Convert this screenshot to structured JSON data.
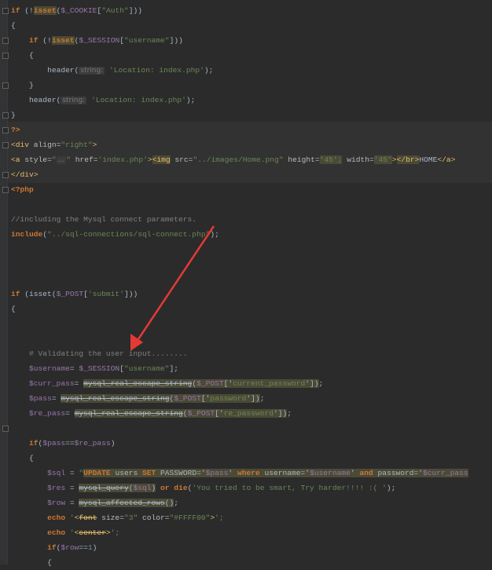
{
  "colors": {
    "background": "#2b2b2b",
    "keyword": "#cc7832",
    "string": "#6a8759",
    "variable": "#9876aa",
    "arrow": "#e53935"
  },
  "annotation": {
    "type": "red-arrow",
    "icon": "arrow-icon"
  },
  "lines": [
    {
      "indent": 0,
      "tokens": [
        {
          "t": "if",
          "c": "kw"
        },
        {
          "t": " (!",
          "c": "fn"
        },
        {
          "t": "isset",
          "c": "kw hl"
        },
        {
          "t": "(",
          "c": "fn"
        },
        {
          "t": "$_COOKIE",
          "c": "var"
        },
        {
          "t": "[",
          "c": "fn"
        },
        {
          "t": "\"Auth\"",
          "c": "str"
        },
        {
          "t": "]))",
          "c": "fn"
        }
      ]
    },
    {
      "indent": 0,
      "tokens": [
        {
          "t": "{",
          "c": "fn"
        }
      ]
    },
    {
      "indent": 1,
      "tokens": [
        {
          "t": "if",
          "c": "kw"
        },
        {
          "t": " (!",
          "c": "fn"
        },
        {
          "t": "isset",
          "c": "kw hl"
        },
        {
          "t": "(",
          "c": "fn"
        },
        {
          "t": "$_SESSION",
          "c": "var"
        },
        {
          "t": "[",
          "c": "fn"
        },
        {
          "t": "\"username\"",
          "c": "str"
        },
        {
          "t": "]))",
          "c": "fn"
        }
      ]
    },
    {
      "indent": 1,
      "tokens": [
        {
          "t": "{",
          "c": "fn"
        }
      ]
    },
    {
      "indent": 2,
      "tokens": [
        {
          "t": "header(",
          "c": "fn"
        },
        {
          "t": "string:",
          "c": "hint"
        },
        {
          "t": " 'Location: index.php'",
          "c": "str"
        },
        {
          "t": ");",
          "c": "fn"
        }
      ]
    },
    {
      "indent": 1,
      "tokens": [
        {
          "t": "}",
          "c": "fn"
        }
      ]
    },
    {
      "indent": 1,
      "tokens": [
        {
          "t": "header(",
          "c": "fn"
        },
        {
          "t": "string:",
          "c": "hint"
        },
        {
          "t": " 'Location: index.php'",
          "c": "str"
        },
        {
          "t": ");",
          "c": "fn"
        }
      ]
    },
    {
      "indent": 0,
      "tokens": [
        {
          "t": "}",
          "c": "fn"
        }
      ]
    },
    {
      "indent": 0,
      "tokens": [
        {
          "t": "?>",
          "c": "kw"
        }
      ]
    },
    {
      "indent": 0,
      "tokens": [
        {
          "t": "<div ",
          "c": "tag"
        },
        {
          "t": "align=",
          "c": "attr"
        },
        {
          "t": "\"right\"",
          "c": "str"
        },
        {
          "t": ">",
          "c": "tag"
        }
      ]
    },
    {
      "indent": 0,
      "tokens": [
        {
          "t": "<a ",
          "c": "tag"
        },
        {
          "t": "style=",
          "c": "attr"
        },
        {
          "t": "\"",
          "c": "str"
        },
        {
          "t": "...",
          "c": "hint"
        },
        {
          "t": "\" ",
          "c": "str"
        },
        {
          "t": "href=",
          "c": "attr"
        },
        {
          "t": "'index.php'",
          "c": "str"
        },
        {
          "t": ">",
          "c": "tag"
        },
        {
          "t": "<img",
          "c": "tag hl"
        },
        {
          "t": " src=",
          "c": "attr"
        },
        {
          "t": "\"../images/Home.png\"",
          "c": "str"
        },
        {
          "t": " height=",
          "c": "attr"
        },
        {
          "t": "'45';",
          "c": "str hl"
        },
        {
          "t": " width=",
          "c": "attr"
        },
        {
          "t": "'45'",
          "c": "str hl"
        },
        {
          "t": ">",
          "c": "tag"
        },
        {
          "t": "</br>",
          "c": "tag hl"
        },
        {
          "t": "HOME",
          "c": "fn"
        },
        {
          "t": "</a>",
          "c": "tag"
        }
      ]
    },
    {
      "indent": 0,
      "tokens": [
        {
          "t": "</div>",
          "c": "tag"
        }
      ]
    },
    {
      "indent": 0,
      "tokens": [
        {
          "t": "<?php",
          "c": "kw"
        }
      ]
    },
    {
      "indent": 0,
      "tokens": []
    },
    {
      "indent": 0,
      "tokens": [
        {
          "t": "//including the Mysql connect parameters.",
          "c": "cm"
        }
      ]
    },
    {
      "indent": 0,
      "tokens": [
        {
          "t": "include",
          "c": "kw"
        },
        {
          "t": "(",
          "c": "fn"
        },
        {
          "t": "\"../sql-connections/sql-connect.php\"",
          "c": "str"
        },
        {
          "t": ");",
          "c": "fn"
        }
      ]
    },
    {
      "indent": 0,
      "tokens": []
    },
    {
      "indent": 0,
      "tokens": []
    },
    {
      "indent": 0,
      "tokens": []
    },
    {
      "indent": 0,
      "tokens": [
        {
          "t": "if",
          "c": "kw"
        },
        {
          "t": " (isset(",
          "c": "fn"
        },
        {
          "t": "$_POST",
          "c": "var"
        },
        {
          "t": "[",
          "c": "fn"
        },
        {
          "t": "'submit'",
          "c": "str"
        },
        {
          "t": "]))",
          "c": "fn"
        }
      ]
    },
    {
      "indent": 0,
      "tokens": [
        {
          "t": "{",
          "c": "fn"
        }
      ]
    },
    {
      "indent": 0,
      "tokens": []
    },
    {
      "indent": 0,
      "tokens": []
    },
    {
      "indent": 1,
      "tokens": [
        {
          "t": "# Validating the user input........",
          "c": "cm"
        }
      ]
    },
    {
      "indent": 1,
      "tokens": [
        {
          "t": "$username",
          "c": "var"
        },
        {
          "t": "= ",
          "c": "fn"
        },
        {
          "t": "$_SESSION",
          "c": "var"
        },
        {
          "t": "[",
          "c": "fn"
        },
        {
          "t": "\"username\"",
          "c": "str"
        },
        {
          "t": "];",
          "c": "fn"
        }
      ]
    },
    {
      "indent": 1,
      "tokens": [
        {
          "t": "$curr_pass",
          "c": "var"
        },
        {
          "t": "= ",
          "c": "fn"
        },
        {
          "t": "mysql_real_escape_string",
          "c": "fn hl del"
        },
        {
          "t": "(",
          "c": "fn hl"
        },
        {
          "t": "$_POST",
          "c": "var hl"
        },
        {
          "t": "['",
          "c": "fn hl"
        },
        {
          "t": "current_password",
          "c": "str hl"
        },
        {
          "t": "'])",
          "c": "fn hl"
        },
        {
          "t": ";",
          "c": "fn"
        }
      ]
    },
    {
      "indent": 1,
      "tokens": [
        {
          "t": "$pass",
          "c": "var"
        },
        {
          "t": "= ",
          "c": "fn"
        },
        {
          "t": "mysql_real_escape_string",
          "c": "fn hl del"
        },
        {
          "t": "(",
          "c": "fn hl"
        },
        {
          "t": "$_POST",
          "c": "var hl"
        },
        {
          "t": "['",
          "c": "fn hl"
        },
        {
          "t": "password",
          "c": "str hl"
        },
        {
          "t": "'])",
          "c": "fn hl"
        },
        {
          "t": ";",
          "c": "fn"
        }
      ]
    },
    {
      "indent": 1,
      "tokens": [
        {
          "t": "$re_pass",
          "c": "var"
        },
        {
          "t": "= ",
          "c": "fn"
        },
        {
          "t": "mysql_real_escape_string",
          "c": "fn hl del"
        },
        {
          "t": "(",
          "c": "fn hl"
        },
        {
          "t": "$_POST",
          "c": "var hl"
        },
        {
          "t": "['",
          "c": "fn hl"
        },
        {
          "t": "re_password",
          "c": "str hl"
        },
        {
          "t": "'])",
          "c": "fn hl"
        },
        {
          "t": ";",
          "c": "fn"
        }
      ]
    },
    {
      "indent": 0,
      "tokens": []
    },
    {
      "indent": 1,
      "tokens": [
        {
          "t": "if",
          "c": "kw"
        },
        {
          "t": "(",
          "c": "fn"
        },
        {
          "t": "$pass",
          "c": "var"
        },
        {
          "t": "==",
          "c": "fn"
        },
        {
          "t": "$re_pass",
          "c": "var"
        },
        {
          "t": ")",
          "c": "fn"
        }
      ]
    },
    {
      "indent": 1,
      "tokens": [
        {
          "t": "{",
          "c": "fn"
        }
      ]
    },
    {
      "indent": 2,
      "tokens": [
        {
          "t": "$sql",
          "c": "var"
        },
        {
          "t": " = ",
          "c": "fn"
        },
        {
          "t": "\"",
          "c": "str"
        },
        {
          "t": "UPDATE",
          "c": "kw hl"
        },
        {
          "t": " users ",
          "c": "fn hl"
        },
        {
          "t": "SET",
          "c": "kw hl"
        },
        {
          "t": " PASSWORD='",
          "c": "fn hl"
        },
        {
          "t": "$pass",
          "c": "var hl"
        },
        {
          "t": "' ",
          "c": "fn hl"
        },
        {
          "t": "where",
          "c": "kw hl"
        },
        {
          "t": " username='",
          "c": "fn hl"
        },
        {
          "t": "$username",
          "c": "var hl"
        },
        {
          "t": "' ",
          "c": "fn hl"
        },
        {
          "t": "and",
          "c": "kw hl"
        },
        {
          "t": " password='",
          "c": "fn hl"
        },
        {
          "t": "$curr_pass",
          "c": "var hl"
        }
      ]
    },
    {
      "indent": 2,
      "tokens": [
        {
          "t": "$res",
          "c": "var"
        },
        {
          "t": " = ",
          "c": "fn"
        },
        {
          "t": "mysql_query",
          "c": "fn hl del"
        },
        {
          "t": "(",
          "c": "fn hl"
        },
        {
          "t": "$sql",
          "c": "var hl"
        },
        {
          "t": ")",
          "c": "fn hl"
        },
        {
          "t": " or die",
          "c": "kw"
        },
        {
          "t": "(",
          "c": "fn"
        },
        {
          "t": "'You tried to be smart, Try harder!!!! :( '",
          "c": "str"
        },
        {
          "t": ");",
          "c": "fn"
        }
      ]
    },
    {
      "indent": 2,
      "tokens": [
        {
          "t": "$row",
          "c": "var"
        },
        {
          "t": " = ",
          "c": "fn"
        },
        {
          "t": "mysql_affected_rows",
          "c": "fn hl del"
        },
        {
          "t": "()",
          "c": "fn hl"
        },
        {
          "t": ";",
          "c": "fn"
        }
      ]
    },
    {
      "indent": 2,
      "tokens": [
        {
          "t": "echo",
          "c": "kw"
        },
        {
          "t": " '",
          "c": "str"
        },
        {
          "t": "<",
          "c": "tag"
        },
        {
          "t": "font",
          "c": "tag del"
        },
        {
          "t": " size=",
          "c": "attr"
        },
        {
          "t": "\"3\"",
          "c": "str"
        },
        {
          "t": " color=",
          "c": "attr"
        },
        {
          "t": "\"#FFFF00\"",
          "c": "str"
        },
        {
          "t": ">",
          "c": "tag"
        },
        {
          "t": "';",
          "c": "str"
        }
      ]
    },
    {
      "indent": 2,
      "tokens": [
        {
          "t": "echo",
          "c": "kw"
        },
        {
          "t": " '",
          "c": "str"
        },
        {
          "t": "<",
          "c": "tag"
        },
        {
          "t": "center",
          "c": "tag del"
        },
        {
          "t": ">",
          "c": "tag"
        },
        {
          "t": "';",
          "c": "str"
        }
      ]
    },
    {
      "indent": 2,
      "tokens": [
        {
          "t": "if",
          "c": "kw"
        },
        {
          "t": "(",
          "c": "fn"
        },
        {
          "t": "$row",
          "c": "var"
        },
        {
          "t": "==",
          "c": "fn"
        },
        {
          "t": "1",
          "c": "num"
        },
        {
          "t": ")",
          "c": "fn"
        }
      ]
    },
    {
      "indent": 2,
      "tokens": [
        {
          "t": "{",
          "c": "fn"
        }
      ]
    }
  ]
}
